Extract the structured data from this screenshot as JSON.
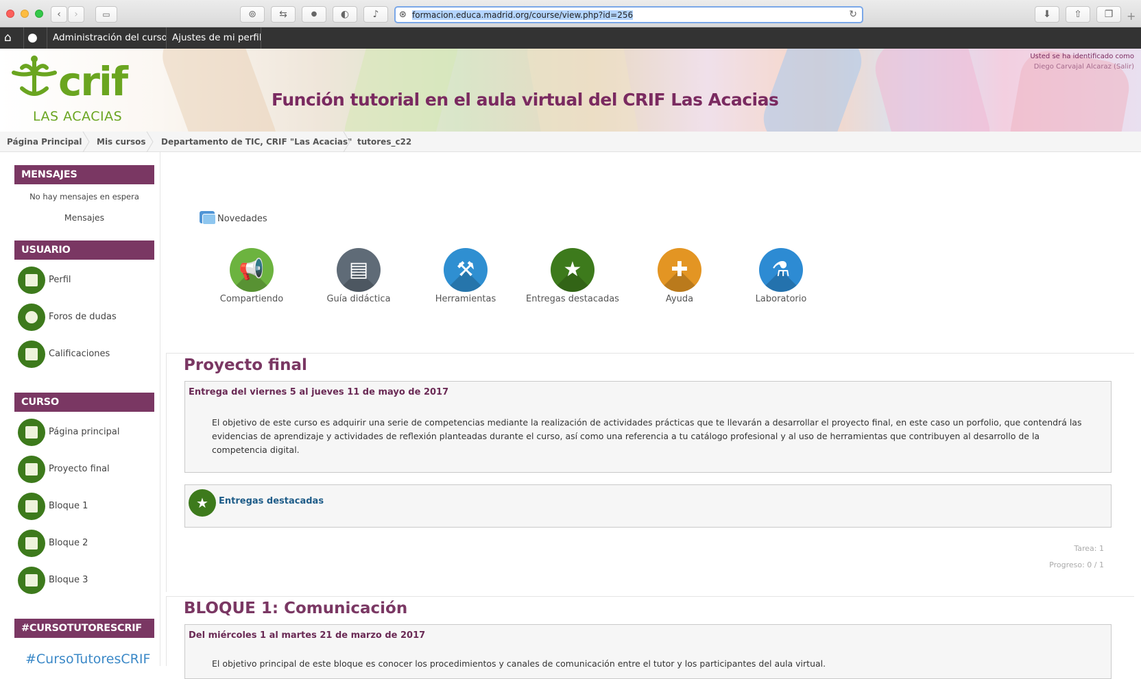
{
  "browser": {
    "url_prefix": "formacion.educa.madrid.org",
    "url_rest": "/course/view.php?id=256"
  },
  "navbar": {
    "admin": "Administración del curso",
    "profile_settings": "Ajustes de mi perfil"
  },
  "header": {
    "logo_main": "crif",
    "logo_sub": "LAS ACACIAS",
    "title": "Función tutorial en el aula virtual del CRIF Las Acacias",
    "logged_line1": "Usted se ha identificado como",
    "logged_line2": "Diego Carvajal Alcaraz (Salir)"
  },
  "breadcrumb": [
    "Página Principal",
    "Mis cursos",
    "Departamento de TIC, CRIF \"Las Acacias\"",
    "tutores_c22"
  ],
  "sidebar": {
    "messages": {
      "title": "MENSAJES",
      "empty": "No hay mensajes en espera",
      "link": "Mensajes"
    },
    "user": {
      "title": "USUARIO",
      "items": [
        "Perfil",
        "Foros de dudas",
        "Calificaciones"
      ]
    },
    "course": {
      "title": "CURSO",
      "items": [
        "Página principal",
        "Proyecto final",
        "Bloque 1",
        "Bloque 2",
        "Bloque 3"
      ]
    },
    "hashtag_block": {
      "title": "#CURSOTUTORESCRIF",
      "hashtag": "#CursoTutoresCRIF"
    }
  },
  "main": {
    "news": "Novedades",
    "tiles": [
      {
        "label": "Compartiendo",
        "color": "#6cb33f",
        "icon": "megaphone-icon"
      },
      {
        "label": "Guía didáctica",
        "color": "#5f6b77",
        "icon": "notebook-icon"
      },
      {
        "label": "Herramientas",
        "color": "#2f8fd1",
        "icon": "tools-icon"
      },
      {
        "label": "Entregas destacadas",
        "color": "#3d7a1c",
        "icon": "star-icon"
      },
      {
        "label": "Ayuda",
        "color": "#e39523",
        "icon": "help-icon"
      },
      {
        "label": "Laboratorio",
        "color": "#2d8bd3",
        "icon": "flask-icon"
      }
    ],
    "sections": [
      {
        "title": "Proyecto final",
        "summary_head": "Entrega del viernes 5 al jueves 11 de mayo de 2017",
        "summary": "El objetivo de este curso es adquirir una serie de competencias mediante la realización de actividades prácticas que te llevarán a desarrollar el proyecto final, en este caso un porfolio, que contendrá las evidencias de aprendizaje y actividades de reflexión planteadas durante el curso, así como una referencia a tu catálogo profesional y al uso de herramientas que contribuyen al desarrollo de la competencia digital.",
        "activity": "Entregas destacadas",
        "tasks": "Tarea: 1",
        "progress": "Progreso: 0 / 1"
      },
      {
        "title": "BLOQUE 1: Comunicación",
        "summary_head": "Del miércoles 1 al martes 21 de marzo de 2017",
        "summary": "El objetivo principal de este bloque es conocer los procedimientos y canales de comunicación entre el tutor y los participantes del aula virtual."
      }
    ]
  }
}
